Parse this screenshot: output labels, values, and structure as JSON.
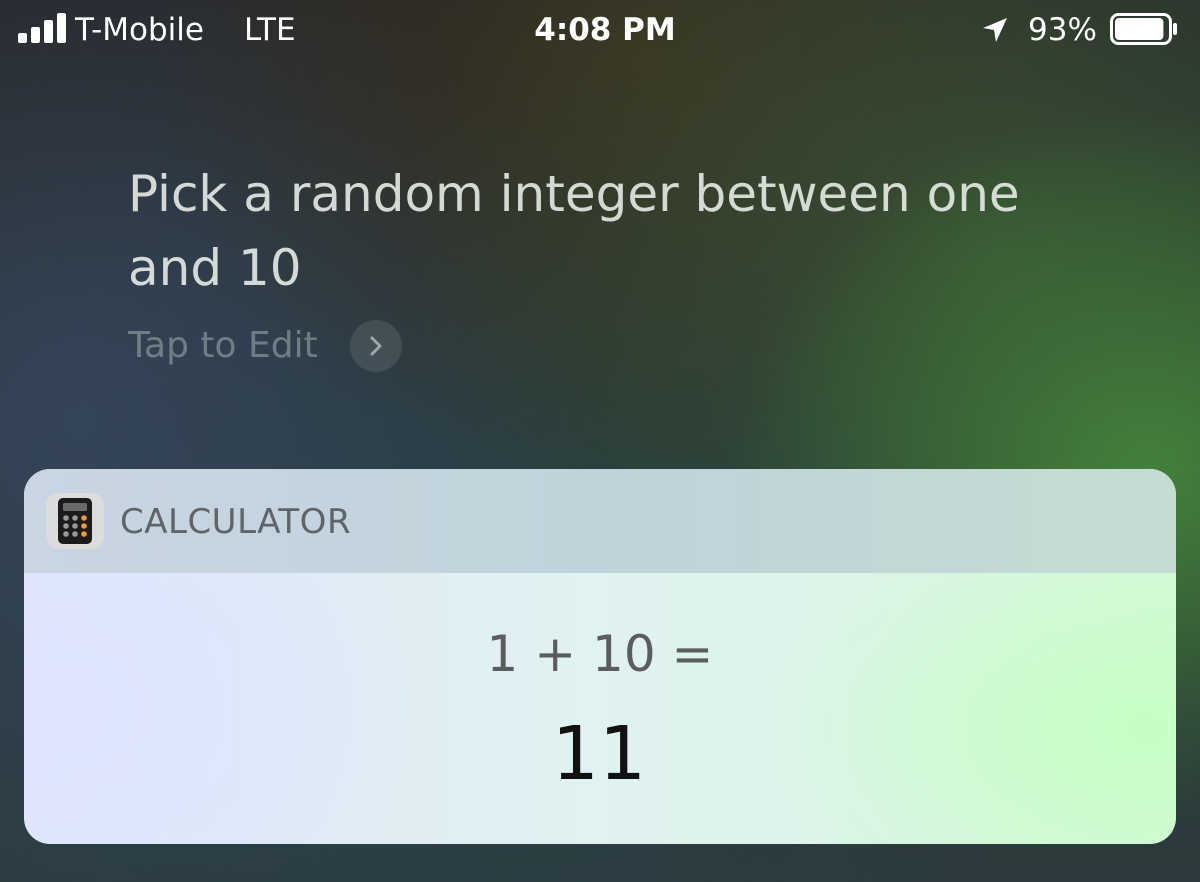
{
  "status_bar": {
    "carrier": "T-Mobile",
    "network": "LTE",
    "time": "4:08 PM",
    "battery_percent": "93%",
    "battery_level": 0.93,
    "signal_bars": 4,
    "icons": [
      "signal-bars-icon",
      "location-arrow-icon",
      "battery-icon"
    ]
  },
  "siri": {
    "query": "Pick a random integer between one and 10",
    "tap_to_edit_label": "Tap to Edit",
    "chevron_icon": "chevron-right-icon"
  },
  "card": {
    "app_name": "CALCULATOR",
    "app_icon": "calculator-icon",
    "expression": "1 + 10 =",
    "result": "11"
  },
  "colors": {
    "card_text": "#5a5c5e",
    "result_text": "#111111",
    "calculator_orange": "#f09a36"
  }
}
